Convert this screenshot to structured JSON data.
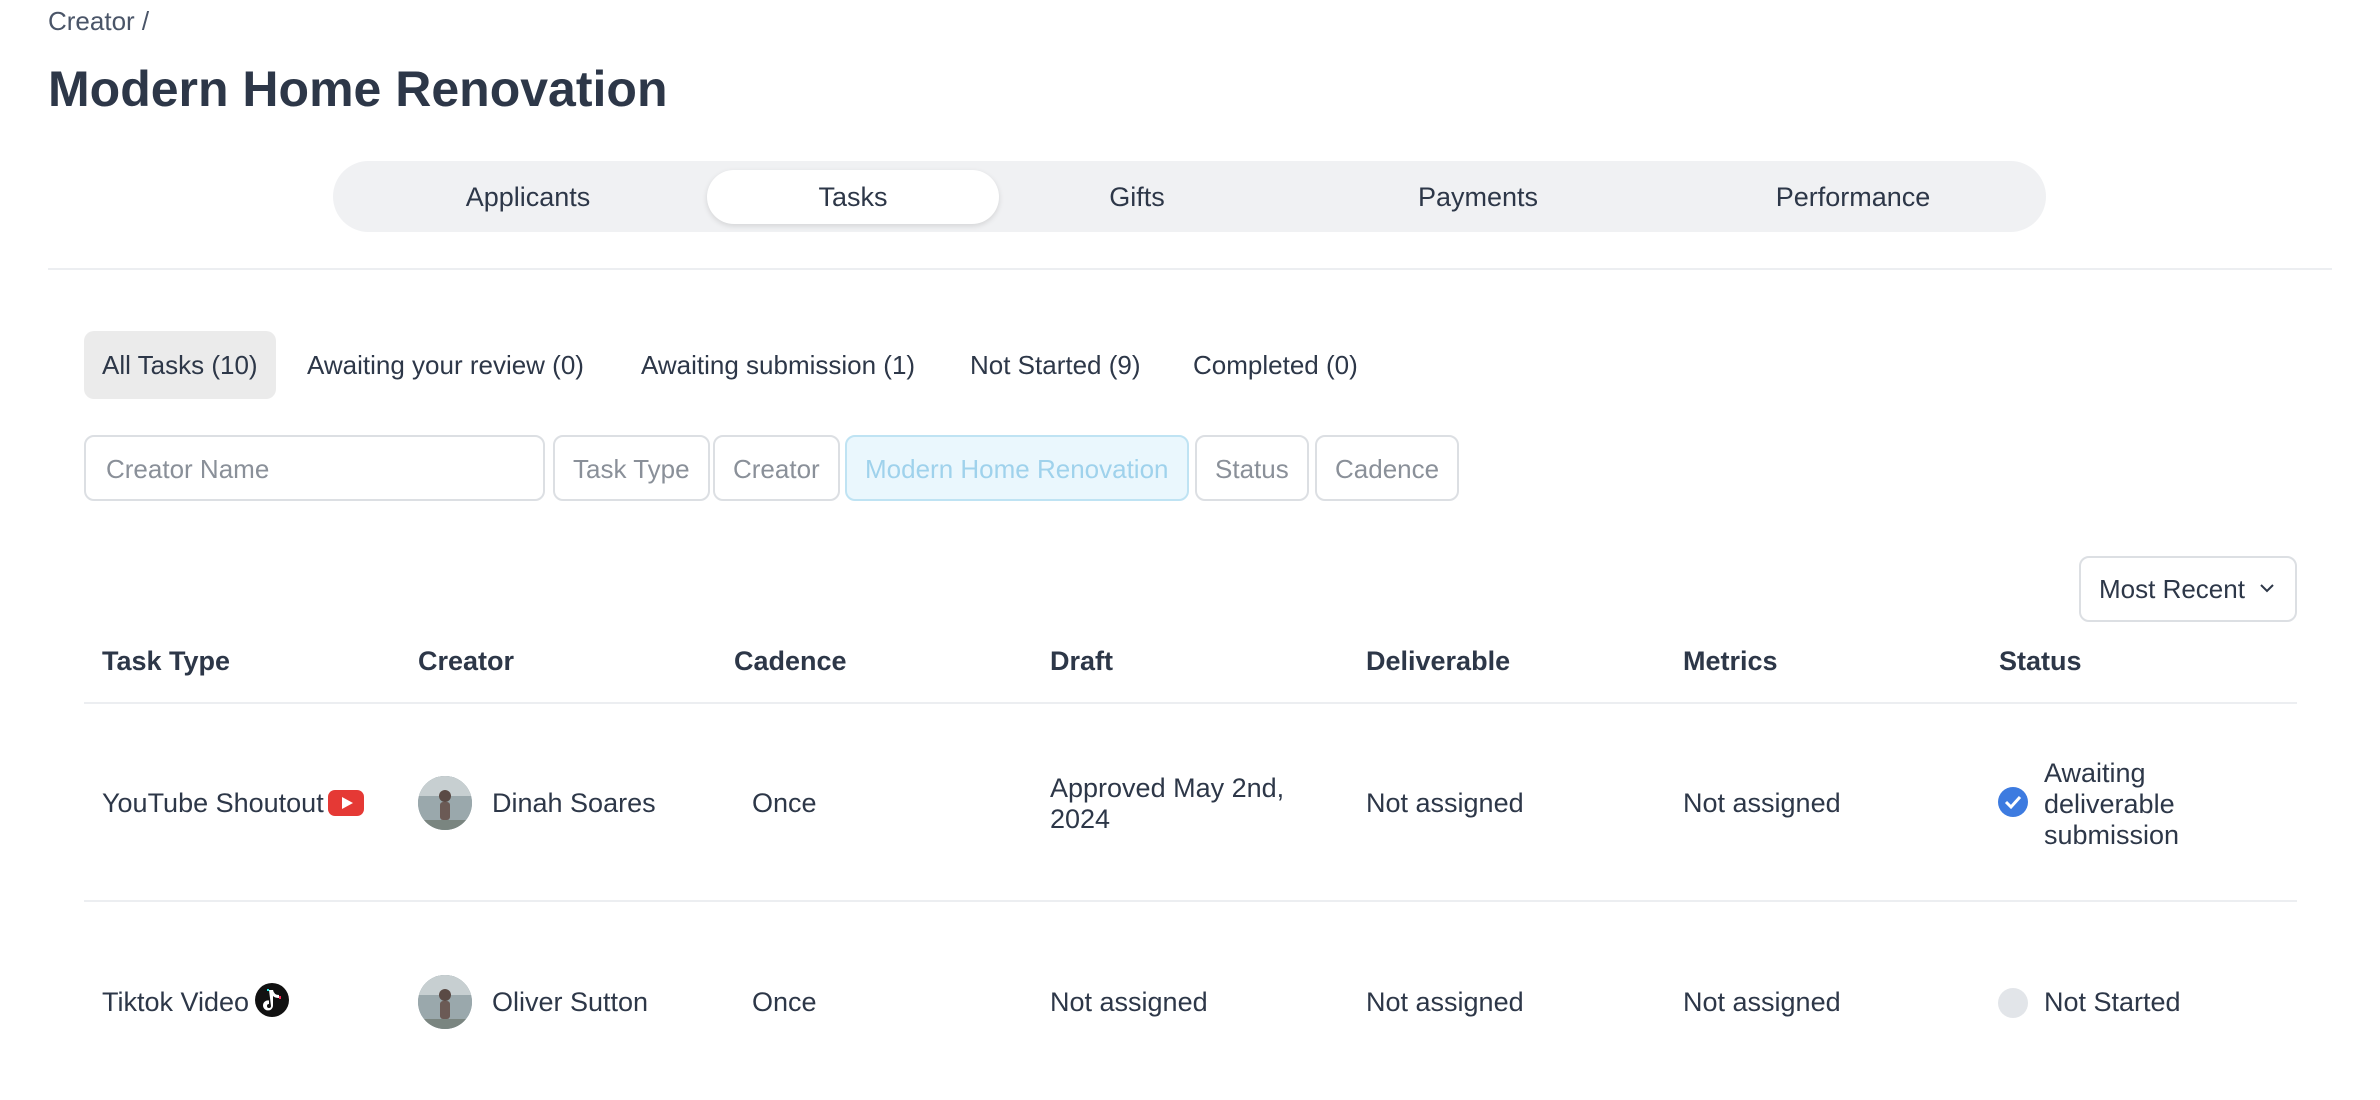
{
  "breadcrumb": "Creator /",
  "page_title": "Modern Home Renovation",
  "main_tabs": {
    "applicants": "Applicants",
    "tasks": "Tasks",
    "gifts": "Gifts",
    "payments": "Payments",
    "performance": "Performance",
    "active": "Tasks"
  },
  "sub_tabs": {
    "all": "All Tasks (10)",
    "review": "Awaiting your review (0)",
    "submission": "Awaiting submission (1)",
    "not_started": "Not Started (9)",
    "completed": "Completed (0)",
    "active": "All Tasks (10)"
  },
  "filters": {
    "creator_name_placeholder": "Creator Name",
    "task_type": "Task Type",
    "creator": "Creator",
    "campaign": "Modern Home Renovation",
    "status": "Status",
    "cadence": "Cadence"
  },
  "sort": {
    "label": "Most Recent"
  },
  "table": {
    "headers": {
      "task_type": "Task Type",
      "creator": "Creator",
      "cadence": "Cadence",
      "draft": "Draft",
      "deliverable": "Deliverable",
      "metrics": "Metrics",
      "status": "Status"
    },
    "rows": [
      {
        "task_type": "YouTube Shoutout",
        "task_icon": "youtube-icon",
        "creator": "Dinah Soares",
        "cadence": "Once",
        "draft_line1": "Approved May 2nd,",
        "draft_line2": "2024",
        "deliverable": "Not assigned",
        "metrics": "Not assigned",
        "status_line1": "Awaiting",
        "status_line2": "deliverable",
        "status_line3": "submission",
        "status_icon": "check-circle-icon"
      },
      {
        "task_type": "Tiktok Video",
        "task_icon": "tiktok-icon",
        "creator": "Oliver Sutton",
        "cadence": "Once",
        "draft": "Not assigned",
        "deliverable": "Not assigned",
        "metrics": "Not assigned",
        "status": "Not Started",
        "status_icon": "empty-circle-icon"
      }
    ]
  },
  "colors": {
    "accent_blue": "#3d7be0",
    "youtube_red": "#e53935",
    "tab_bar_bg": "#f0f1f3",
    "selected_filter_bg": "#eaf7fd"
  }
}
